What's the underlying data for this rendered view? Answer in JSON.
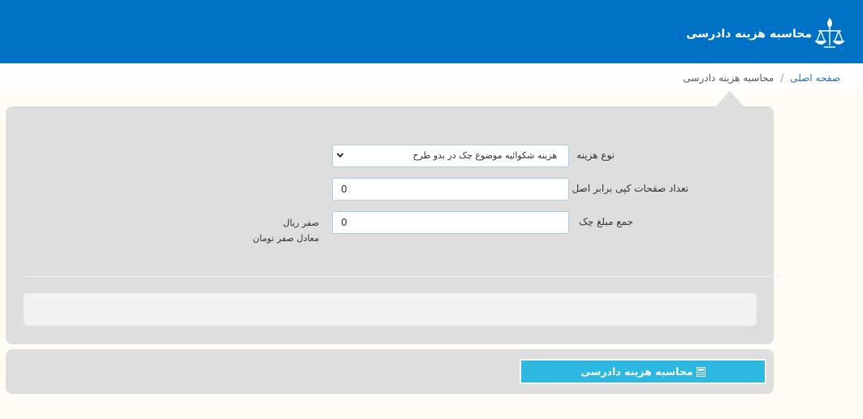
{
  "header": {
    "title": "محاسبه هزینه دادرسی",
    "logo_icon": "scales-of-justice-emblem-icon"
  },
  "breadcrumb": {
    "home": "صفحه اصلی",
    "separator": "/",
    "current": "محاسبه هزینه دادرسی"
  },
  "form": {
    "cost_type": {
      "label": "نوع هزینه",
      "selected": "هزینه شکوائیه موضوع چک در بدو طرح"
    },
    "copy_pages": {
      "label": "تعداد صفحات کپی برابر اصل",
      "value": "0"
    },
    "check_amount": {
      "label": "جمع مبلغ چک",
      "value": "0",
      "rial_text": "صفر ریال",
      "toman_text": "معادل صفر تومان"
    }
  },
  "actions": {
    "calculate_label": "محاسبه هزینه دادرسی",
    "calculate_icon": "calculator-icon"
  },
  "colors": {
    "header_bg": "#0072c6",
    "button_bg": "#2cb8e0",
    "panel_bg": "#dedede",
    "page_bg": "#fffbf5"
  }
}
